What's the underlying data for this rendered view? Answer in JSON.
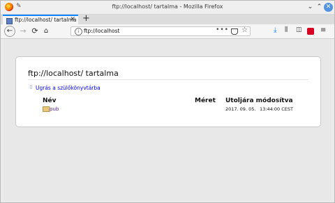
{
  "window": {
    "title": "ftp://localhost/ tartalma - Mozilla Firefox",
    "controls": {
      "minimize": "⌄",
      "maximize": "⌃",
      "close": "✕"
    }
  },
  "tab": {
    "label": "ftp://localhost/ tartalma",
    "close": "✕"
  },
  "new_tab_label": "+",
  "nav": {
    "back": "←",
    "forward": "→",
    "reload": "⟳",
    "home": "⌂",
    "url": "ftp://localhost",
    "page_actions": "•••",
    "bookmark_star": "☆",
    "download": "⤓",
    "library": "⫼",
    "sidebar": "◫",
    "menu": "≡"
  },
  "page": {
    "heading": "ftp://localhost/ tartalma",
    "up_link": "Ugrás a szülőkönyvtárba",
    "up_icon": "⇧",
    "columns": {
      "name": "Név",
      "size": "Méret",
      "modified": "Utoljára módosítva"
    },
    "rows": [
      {
        "name": "pub",
        "date": "2017. 09. 05.",
        "time": "13:44:00 CEST",
        "icon": "folder-icon"
      }
    ]
  }
}
